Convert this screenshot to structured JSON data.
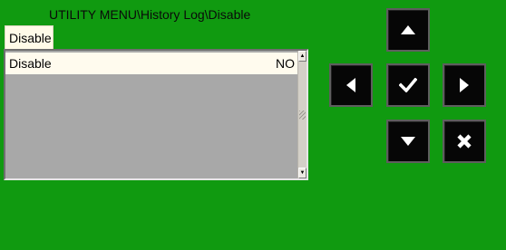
{
  "breadcrumb": "UTILITY MENU\\History Log\\Disable",
  "tab": {
    "label": "Disable"
  },
  "list": {
    "rows": [
      {
        "label": "Disable",
        "value": "NO"
      }
    ]
  },
  "buttons": {
    "up": "up-arrow-icon",
    "left": "left-arrow-icon",
    "ok": "checkmark-icon",
    "right": "right-arrow-icon",
    "down": "down-arrow-icon",
    "cancel": "x-icon"
  },
  "colors": {
    "background": "#109a10",
    "panel": "#a8a8a8",
    "selected_row": "#fffbee",
    "button": "#060606"
  }
}
